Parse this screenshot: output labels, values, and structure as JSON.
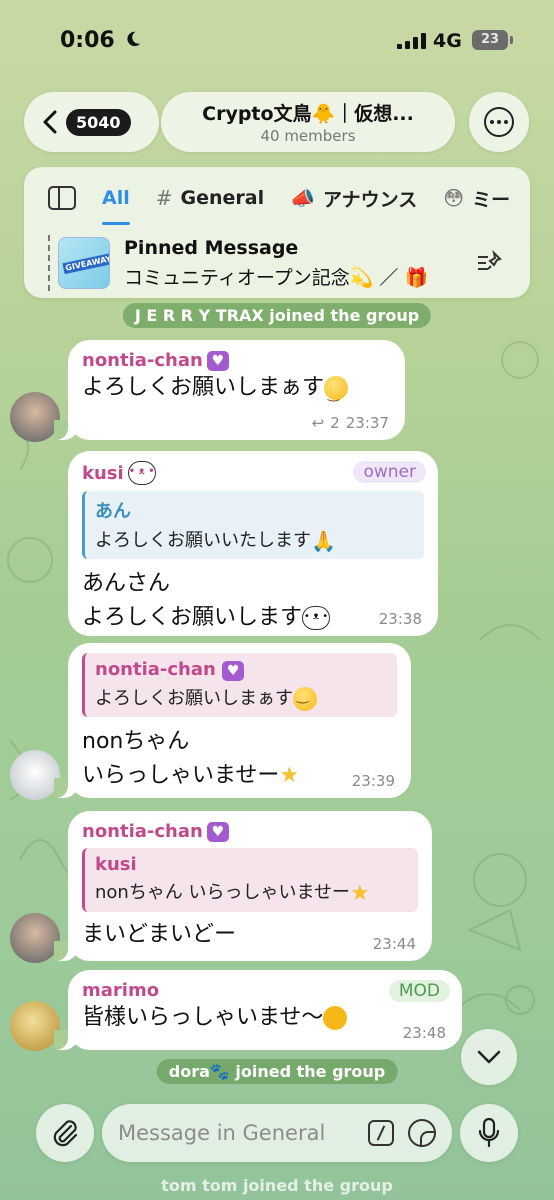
{
  "status": {
    "time": "0:06",
    "network": "4G",
    "battery": "23"
  },
  "header": {
    "back_count": "5040",
    "title": "Crypto文鳥🐥｜仮想...",
    "members": "40 members"
  },
  "topics": {
    "tabs": [
      {
        "label": "All",
        "icon": ""
      },
      {
        "label": "General",
        "icon": "#"
      },
      {
        "label": "アナウンス",
        "icon": "📣"
      },
      {
        "label": "ミー",
        "icon": "😳"
      }
    ]
  },
  "pinned": {
    "title": "Pinned Message",
    "text": "コミュニティオープン記念💫 ／ 🎁",
    "thumb_label": "GIVEAWAY"
  },
  "service": {
    "jerry": "J E R R Y TRAX joined the group",
    "dora": "dora🐾 joined the group",
    "tom": "tom tom joined the group"
  },
  "messages": [
    {
      "sender": "nontia-chan",
      "text": "よろしくお願いしまぁす",
      "replies": "2",
      "time": "23:37"
    },
    {
      "sender": "kusi",
      "role": "owner",
      "reply_name": "あん",
      "reply_text": "よろしくお願いいたします",
      "text1": "あんさん",
      "text2": "よろしくお願いします",
      "time": "23:38"
    },
    {
      "reply_name": "nontia-chan",
      "reply_text": "よろしくお願いしまぁす",
      "text1": "nonちゃん",
      "text2": "いらっしゃいませー",
      "time": "23:39"
    },
    {
      "sender": "nontia-chan",
      "reply_name": "kusi",
      "reply_text": "nonちゃん いらっしゃいませー",
      "text": "まいどまいどー",
      "time": "23:44"
    },
    {
      "sender": "marimo",
      "role": "MOD",
      "text": "皆様いらっしゃいませ〜",
      "time": "23:48"
    }
  ],
  "composer": {
    "placeholder": "Message in General"
  },
  "colors": {
    "accent": "#2f8fe5",
    "sender_pink": "#c04a8b",
    "owner_badge": "#9b6fc8",
    "mod_badge": "#4f9a4f"
  }
}
